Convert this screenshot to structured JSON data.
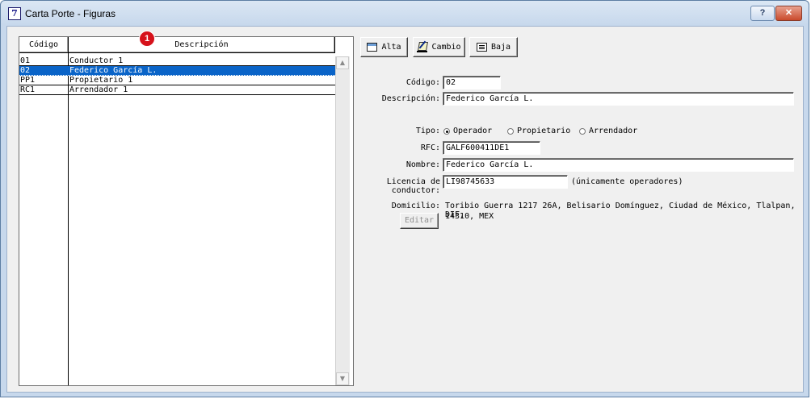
{
  "window": {
    "title": "Carta Porte - Figuras",
    "help_label": "?",
    "close_label": "✕",
    "app_icon_text": "7"
  },
  "badge": "1",
  "list": {
    "headers": {
      "code": "Código",
      "desc": "Descripción"
    },
    "rows": [
      {
        "code": "01",
        "desc": "Conductor 1",
        "selected": false
      },
      {
        "code": "02",
        "desc": "Federico García L.",
        "selected": true
      },
      {
        "code": "PP1",
        "desc": "Propietario 1",
        "selected": false
      },
      {
        "code": "RC1",
        "desc": "Arrendador 1",
        "selected": false
      }
    ]
  },
  "toolbar": {
    "alta": "Alta",
    "cambio": "Cambio",
    "baja": "Baja"
  },
  "form": {
    "codigo_label": "Código:",
    "codigo_value": "02",
    "descripcion_label": "Descripción:",
    "descripcion_value": "Federico García L.",
    "tipo_label": "Tipo:",
    "tipo_options": [
      "Operador",
      "Propietario",
      "Arrendador"
    ],
    "tipo_selected": "Operador",
    "rfc_label": "RFC:",
    "rfc_value": "GALF600411DE1",
    "nombre_label": "Nombre:",
    "nombre_value": "Federico García L.",
    "licencia_label": "Licencia de conductor:",
    "licencia_value": "LI98745633",
    "licencia_note": "(únicamente operadores)",
    "domicilio_label": "Domicilio:",
    "domicilio_line1": "Toribio Guerra 1217 26A, Belisario Domínguez, Ciudad de México, Tlalpan, DIF,",
    "domicilio_line2": "14310, MEX",
    "editar_label": "Editar"
  },
  "colors": {
    "selection": "#0a64c8",
    "badge": "#d6121b",
    "client_bg": "#f0f0f0"
  }
}
